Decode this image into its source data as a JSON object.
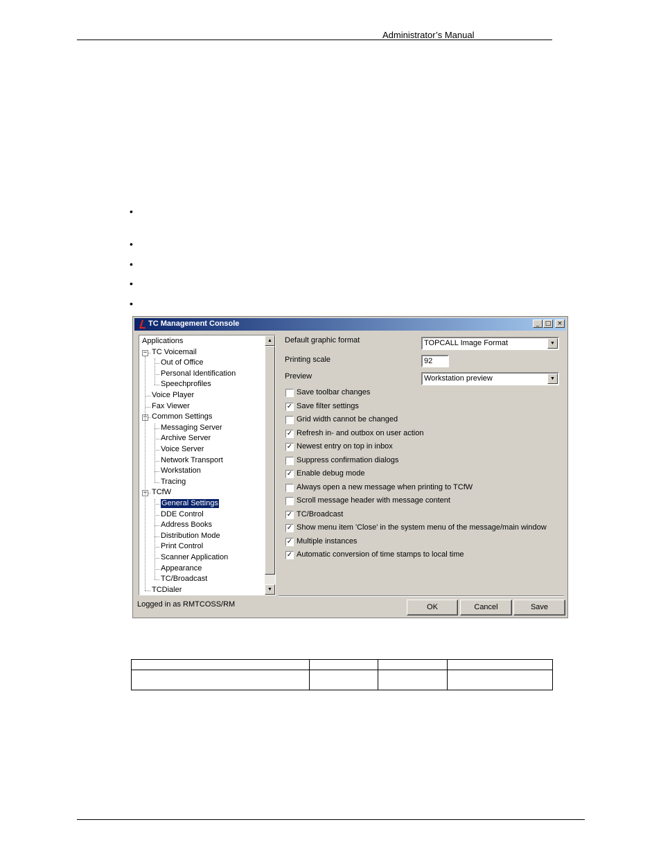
{
  "header": {
    "title": "Administrator’s Manual"
  },
  "window": {
    "title": "TC Management Console",
    "controls": {
      "minimize": "_",
      "maximize": "□",
      "close": "×"
    },
    "tree": [
      {
        "label": "Applications",
        "level": 0
      },
      {
        "label": "TC Voicemail",
        "level": 1,
        "expander": "−"
      },
      {
        "label": "Out of Office",
        "level": 2
      },
      {
        "label": "Personal Identification",
        "level": 2
      },
      {
        "label": "Speechprofiles",
        "level": 2
      },
      {
        "label": "Voice Player",
        "level": 1
      },
      {
        "label": "Fax Viewer",
        "level": 1
      },
      {
        "label": "Common Settings",
        "level": 1,
        "expander": "−"
      },
      {
        "label": "Messaging Server",
        "level": 2
      },
      {
        "label": "Archive Server",
        "level": 2
      },
      {
        "label": "Voice Server",
        "level": 2
      },
      {
        "label": "Network Transport",
        "level": 2
      },
      {
        "label": "Workstation",
        "level": 2
      },
      {
        "label": "Tracing",
        "level": 2
      },
      {
        "label": "TCfW",
        "level": 1,
        "expander": "−"
      },
      {
        "label": "General Settings",
        "level": 2,
        "selected": true
      },
      {
        "label": "DDE Control",
        "level": 2
      },
      {
        "label": "Address Books",
        "level": 2
      },
      {
        "label": "Distribution Mode",
        "level": 2
      },
      {
        "label": "Print Control",
        "level": 2
      },
      {
        "label": "Scanner Application",
        "level": 2
      },
      {
        "label": "Appearance",
        "level": 2
      },
      {
        "label": "TC/Broadcast",
        "level": 2
      },
      {
        "label": "TCDialer",
        "level": 1
      }
    ],
    "settings": {
      "graphic_format_label": "Default graphic format",
      "graphic_format_value": "TOPCALL Image Format",
      "printing_scale_label": "Printing scale",
      "printing_scale_value": "92",
      "preview_label": "Preview",
      "preview_value": "Workstation preview",
      "checkboxes": [
        {
          "label": "Save toolbar changes",
          "checked": false
        },
        {
          "label": "Save filter settings",
          "checked": true
        },
        {
          "label": "Grid width cannot be changed",
          "checked": false
        },
        {
          "label": "Refresh in- and outbox on user action",
          "checked": true
        },
        {
          "label": "Newest entry on top in inbox",
          "checked": true
        },
        {
          "label": "Suppress confirmation dialogs",
          "checked": false
        },
        {
          "label": "Enable debug mode",
          "checked": true
        },
        {
          "label": "Always open a new message when printing to TCfW",
          "checked": false
        },
        {
          "label": "Scroll message header with message content",
          "checked": false
        },
        {
          "label": "TC/Broadcast",
          "checked": true
        },
        {
          "label": "Show menu item 'Close' in the system menu of the message/main window",
          "checked": true
        },
        {
          "label": "Multiple instances",
          "checked": true
        },
        {
          "label": "Automatic conversion of time stamps to local time",
          "checked": true
        }
      ]
    },
    "status": "Logged in as RMTCOSS/RM",
    "buttons": {
      "ok": "OK",
      "cancel": "Cancel",
      "save": "Save"
    }
  }
}
